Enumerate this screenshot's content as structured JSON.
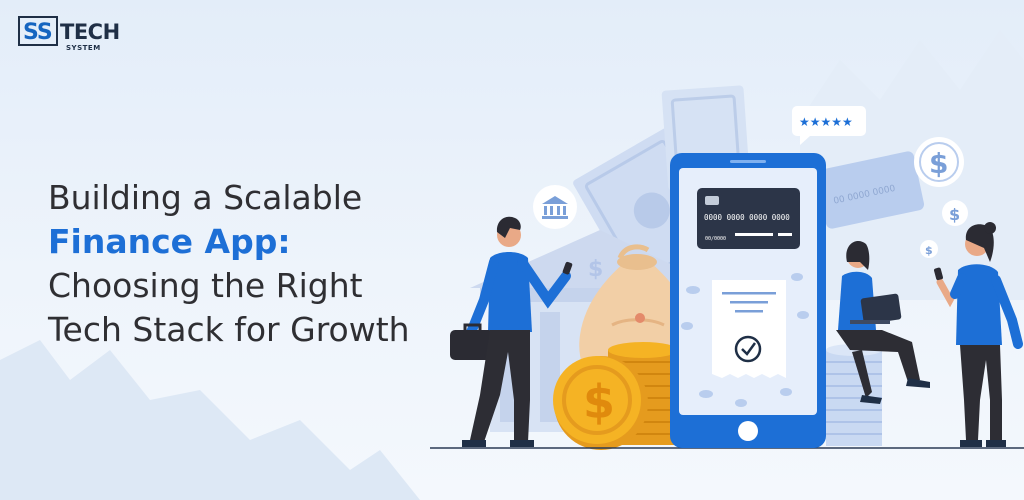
{
  "brand": {
    "mark": "SS",
    "name": "TECH",
    "sub": "SYSTEM"
  },
  "headline": {
    "line1": "Building a Scalable",
    "line2": "Finance App:",
    "line3": "Choosing the Right",
    "line4": "Tech Stack for Growth"
  },
  "card": {
    "number": "0000 0000 0000 0000",
    "expiry": "00/0000"
  },
  "back_card": {
    "number": "00 0000 0000"
  },
  "review": {
    "stars": "★★★★★"
  },
  "colors": {
    "accent": "#1d6fd6",
    "text": "#2f2f33",
    "gold": "#f5b324",
    "dark": "#1f2f46"
  },
  "icons": [
    "bank-icon",
    "dollar-icon",
    "check-icon",
    "star-icon"
  ]
}
